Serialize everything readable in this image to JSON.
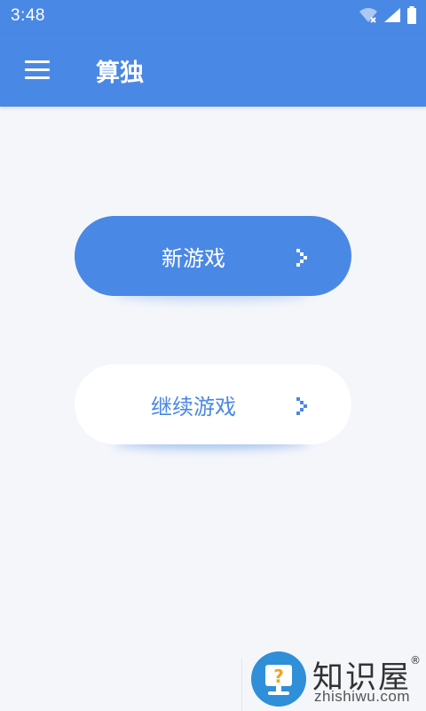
{
  "status_bar": {
    "time": "3:48",
    "icons": [
      "wifi-icon",
      "signal-icon",
      "battery-icon"
    ]
  },
  "app_bar": {
    "title": "算独",
    "menu_icon": "hamburger-menu-icon"
  },
  "buttons": {
    "new_game": "新游戏",
    "continue_game": "继续游戏"
  },
  "watermark": {
    "name_cn": "知识屋",
    "registered": "®",
    "site": "zhishiwu.com",
    "logo_glyph": "?"
  },
  "colors": {
    "primary": "#4a88e5",
    "background": "#f4f6fa",
    "card": "#ffffff"
  }
}
